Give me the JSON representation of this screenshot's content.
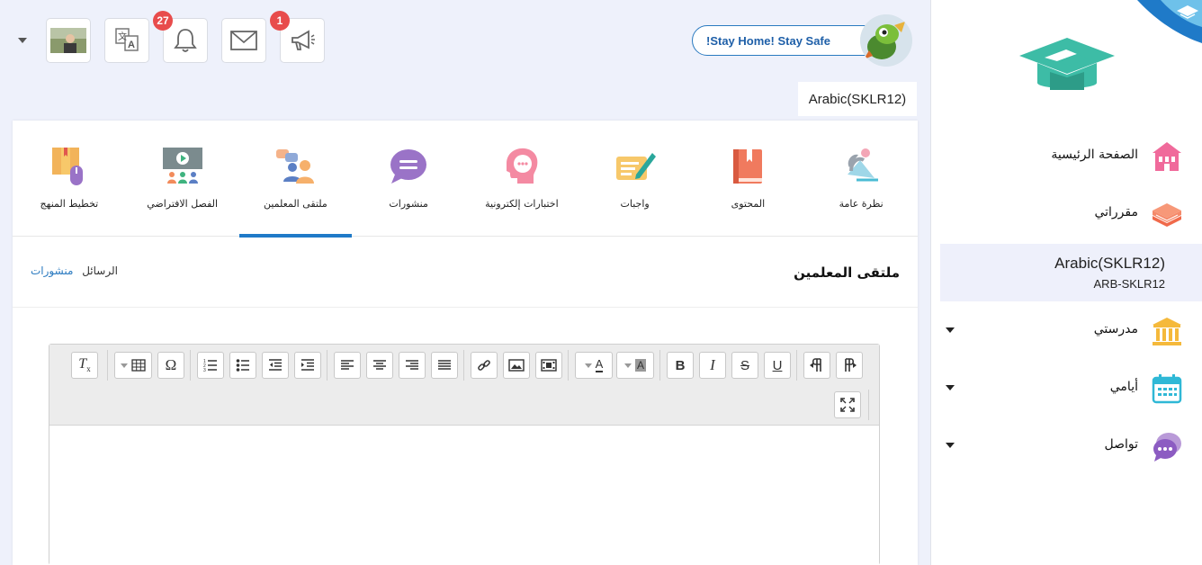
{
  "header": {
    "stay_home": "!Stay Home! Stay Safe",
    "notifications_count": "27",
    "announcements_count": "1"
  },
  "course_label": "Arabic(SKLR12)",
  "tabs": [
    {
      "label": "نظرة عامة",
      "icon": "overview-icon"
    },
    {
      "label": "المحتوى",
      "icon": "book-icon"
    },
    {
      "label": "واجبات",
      "icon": "assignment-icon"
    },
    {
      "label": "اختبارات إلكترونية",
      "icon": "quiz-icon"
    },
    {
      "label": "منشورات",
      "icon": "chat-bubble-icon"
    },
    {
      "label": "ملتقى المعلمين",
      "icon": "teachers-forum-icon"
    },
    {
      "label": "الفصل الافتراضي",
      "icon": "virtual-class-icon"
    },
    {
      "label": "تخطيط المنهج",
      "icon": "curriculum-icon"
    }
  ],
  "active_tab": 5,
  "section": {
    "title": "ملتقى المعلمين",
    "crumb_messages": "الرسائل",
    "crumb_posts": "منشورات"
  },
  "sidebar": {
    "items": [
      {
        "label": "الصفحة الرئيسية",
        "icon": "home-icon"
      },
      {
        "label": "مقرراتي",
        "icon": "books-stack-icon"
      },
      {
        "label": "مدرستي",
        "icon": "school-icon"
      },
      {
        "label": "أيامي",
        "icon": "calendar-icon"
      },
      {
        "label": "تواصل",
        "icon": "chat-icon"
      }
    ],
    "selected_course": {
      "title": "Arabic(SKLR12)",
      "code": "ARB-SKLR12"
    }
  },
  "colors": {
    "accent": "#1f7ac8",
    "badge": "#e84c4c"
  }
}
